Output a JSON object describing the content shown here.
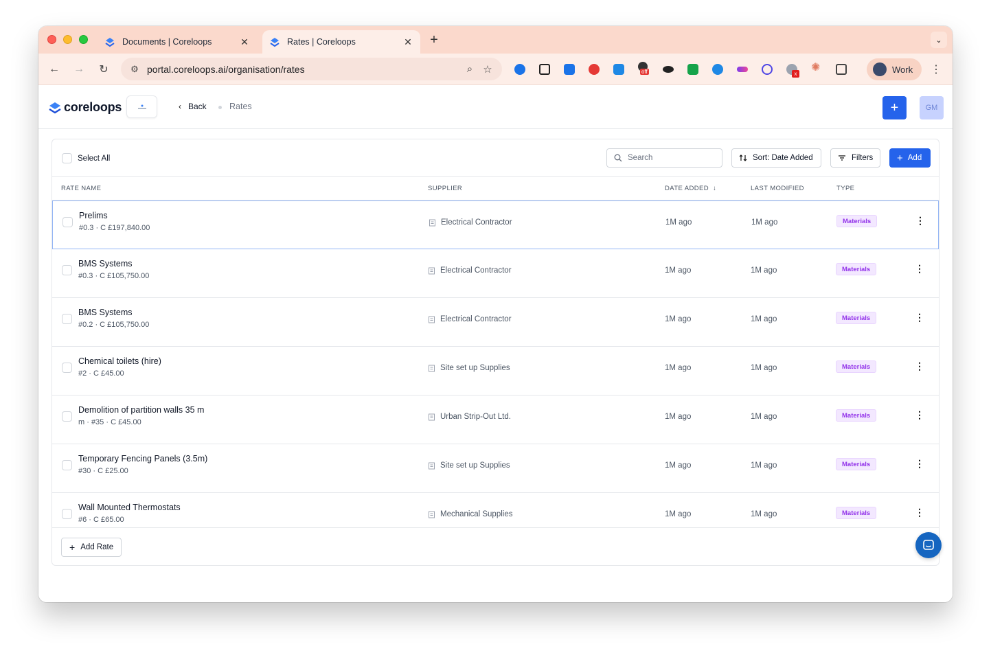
{
  "browser": {
    "tabs": [
      {
        "title": "Documents | Coreloops",
        "active": false
      },
      {
        "title": "Rates | Coreloops",
        "active": true
      }
    ],
    "new_tab": "+",
    "url": "portal.coreloops.ai/organisation/rates",
    "profile_label": "Work",
    "colors": {
      "tab_strip": "#fbd9cc",
      "toolbar": "#fdeee8"
    },
    "extensions": [
      "1password-icon",
      "script-icon",
      "snowflake-icon",
      "pokeball-icon",
      "download-icon",
      "off-badge-icon",
      "puck-icon",
      "green-a-icon",
      "grammarly-icon",
      "waveform-icon",
      "orbit-icon",
      "ghost-x-icon",
      "claude-icon",
      "puzzle-icon"
    ],
    "ext_off_badge": "off",
    "ext_x_badge": "x"
  },
  "header": {
    "brand": "coreloops",
    "back_label": "Back",
    "breadcrumb_current": "Rates",
    "avatar_initials": "GM",
    "accent": "#2563eb"
  },
  "toolbar": {
    "select_all": "Select All",
    "search_placeholder": "Search",
    "sort_label": "Sort: Date Added",
    "filters_label": "Filters",
    "add_label": "Add"
  },
  "table": {
    "columns": {
      "rate_name": "RATE NAME",
      "supplier": "SUPPLIER",
      "date_added": "DATE ADDED",
      "last_modified": "LAST MODIFIED",
      "type": "TYPE"
    },
    "rows": [
      {
        "title": "Prelims",
        "subtitle": "#0.3 · C £197,840.00",
        "supplier": "Electrical Contractor",
        "date_added": "1M ago",
        "last_modified": "1M ago",
        "type": "Materials"
      },
      {
        "title": "BMS Systems",
        "subtitle": "#0.3 · C £105,750.00",
        "supplier": "Electrical Contractor",
        "date_added": "1M ago",
        "last_modified": "1M ago",
        "type": "Materials"
      },
      {
        "title": "BMS Systems",
        "subtitle": "#0.2 · C £105,750.00",
        "supplier": "Electrical Contractor",
        "date_added": "1M ago",
        "last_modified": "1M ago",
        "type": "Materials"
      },
      {
        "title": "Chemical toilets (hire)",
        "subtitle": "#2 · C £45.00",
        "supplier": "Site set up Supplies",
        "date_added": "1M ago",
        "last_modified": "1M ago",
        "type": "Materials"
      },
      {
        "title": "Demolition of partition walls 35 m",
        "subtitle": "m · #35 · C £45.00",
        "supplier": "Urban Strip-Out Ltd.",
        "date_added": "1M ago",
        "last_modified": "1M ago",
        "type": "Materials"
      },
      {
        "title": "Temporary Fencing Panels (3.5m)",
        "subtitle": "#30 · C £25.00",
        "supplier": "Site set up Supplies",
        "date_added": "1M ago",
        "last_modified": "1M ago",
        "type": "Materials"
      },
      {
        "title": "Wall Mounted Thermostats",
        "subtitle": "#6 · C £65.00",
        "supplier": "Mechanical Supplies",
        "date_added": "1M ago",
        "last_modified": "1M ago",
        "type": "Materials"
      }
    ]
  },
  "footer": {
    "add_rate_label": "Add Rate"
  }
}
